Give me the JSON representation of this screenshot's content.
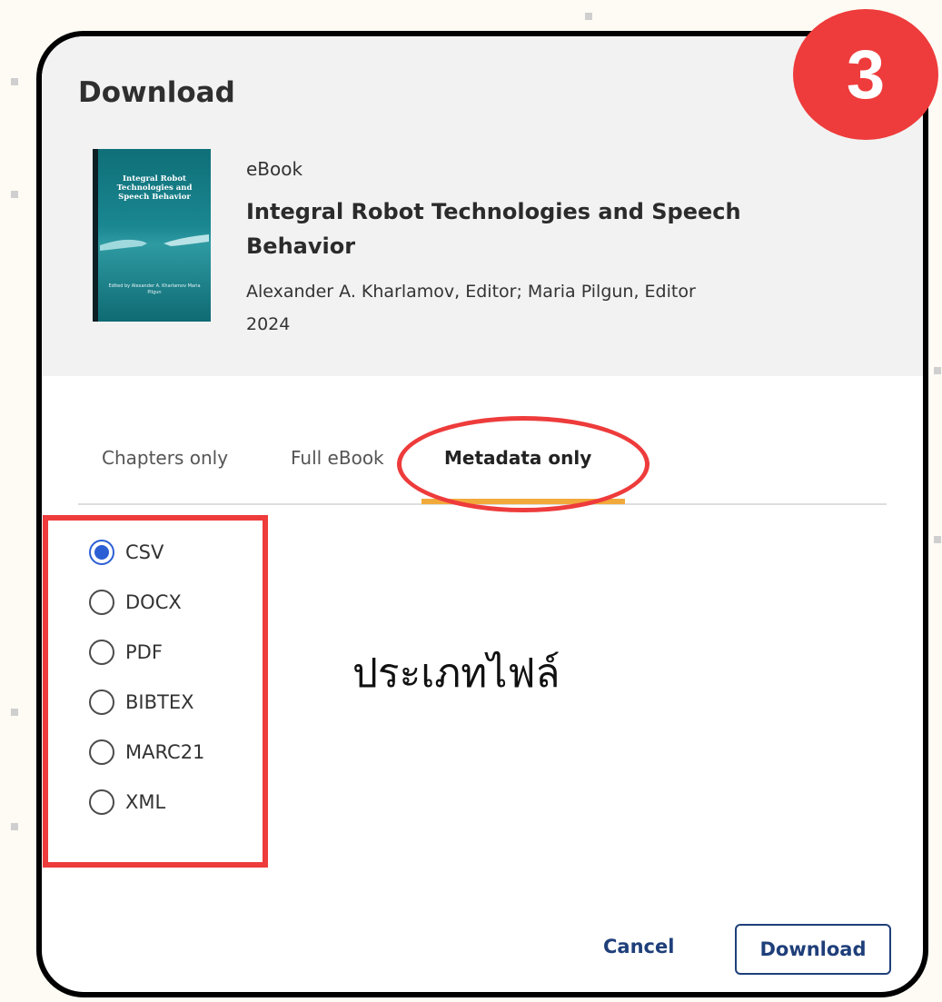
{
  "dialog": {
    "title": "Download",
    "book": {
      "type": "eBook",
      "title": "Integral Robot Technologies and Speech Behavior",
      "authors": "Alexander A. Kharlamov, Editor; Maria Pilgun, Editor",
      "year": "2024",
      "cover_title": "Integral Robot Technologies and Speech Behavior",
      "cover_editors": "Edited by Alexander A. Kharlamov Maria Pilgun"
    },
    "tabs": [
      {
        "label": "Chapters only",
        "selected": false
      },
      {
        "label": "Full eBook",
        "selected": false
      },
      {
        "label": "Metadata only",
        "selected": true
      }
    ],
    "formats": [
      {
        "label": "CSV",
        "checked": true
      },
      {
        "label": "DOCX",
        "checked": false
      },
      {
        "label": "PDF",
        "checked": false
      },
      {
        "label": "BIBTEX",
        "checked": false
      },
      {
        "label": "MARC21",
        "checked": false
      },
      {
        "label": "XML",
        "checked": false
      }
    ],
    "cancel_label": "Cancel",
    "download_label": "Download"
  },
  "annotation": {
    "step": "3",
    "file_type_note": "ประเภทไฟล์",
    "highlight_color": "#ee3b3b",
    "accent_color": "#f2a93b",
    "link_color": "#1f3f7a"
  }
}
